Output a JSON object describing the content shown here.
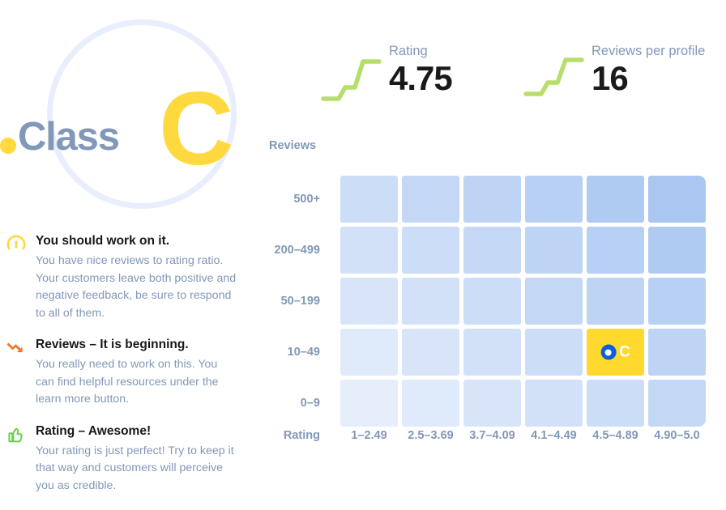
{
  "emblem": {
    "word": "Class",
    "letter": "C",
    "dot_color": "#ffd93d",
    "ring_color": "#e8eefb",
    "word_color": "#8298b8"
  },
  "metrics": [
    {
      "label": "Rating",
      "value": "4.75",
      "sparkline_icon": "step-up-sparkline-icon",
      "sparkline_color": "#b7de6a"
    },
    {
      "label": "Reviews per profile",
      "value": "16",
      "sparkline_icon": "step-up-sparkline-icon",
      "sparkline_color": "#b7de6a"
    }
  ],
  "advice": {
    "items": [
      {
        "icon": "gauge-icon",
        "icon_color": "#ffd93d",
        "title": "You should work on it.",
        "body": "You have nice reviews to rating ratio. Your customers leave both positive and negative feedback, be sure to respond to all of them."
      },
      {
        "icon": "trend-down-icon",
        "icon_color": "#f4762a",
        "title": "Reviews – It is beginning.",
        "body": "You really need to work on this. You can find helpful resources under the learn more button."
      },
      {
        "icon": "thumbs-up-icon",
        "icon_color": "#68d14c",
        "title": "Rating – Awesome!",
        "body": "Your rating is just perfect! Try to keep it that way and customers will perceive you as credible."
      }
    ]
  },
  "chart_data": {
    "type": "heatmap",
    "title": "",
    "ylabel": "Reviews",
    "xlabel": "Rating",
    "y_categories": [
      "500+",
      "200–499",
      "50–199",
      "10–49",
      "0–9"
    ],
    "x_categories": [
      "1–2.49",
      "2.5–3.69",
      "3.7–4.09",
      "4.1–4.49",
      "4.5–4.89",
      "4.90–5.0"
    ],
    "grid": false,
    "legend_position": "none",
    "colorscale": [
      "#e6eefc",
      "#a9c7f0"
    ],
    "highlight": {
      "row": "10–49",
      "col": "4.5–4.89",
      "label": "C",
      "color": "#ffd92e",
      "marker_color": "#0a5fe0"
    },
    "values": [
      [
        4,
        5,
        6,
        7,
        8,
        9
      ],
      [
        3,
        4,
        5,
        6,
        7,
        8
      ],
      [
        2,
        3,
        4,
        5,
        6,
        7
      ],
      [
        1,
        2,
        3,
        4,
        5,
        6
      ],
      [
        0,
        1,
        2,
        3,
        4,
        5
      ]
    ]
  }
}
